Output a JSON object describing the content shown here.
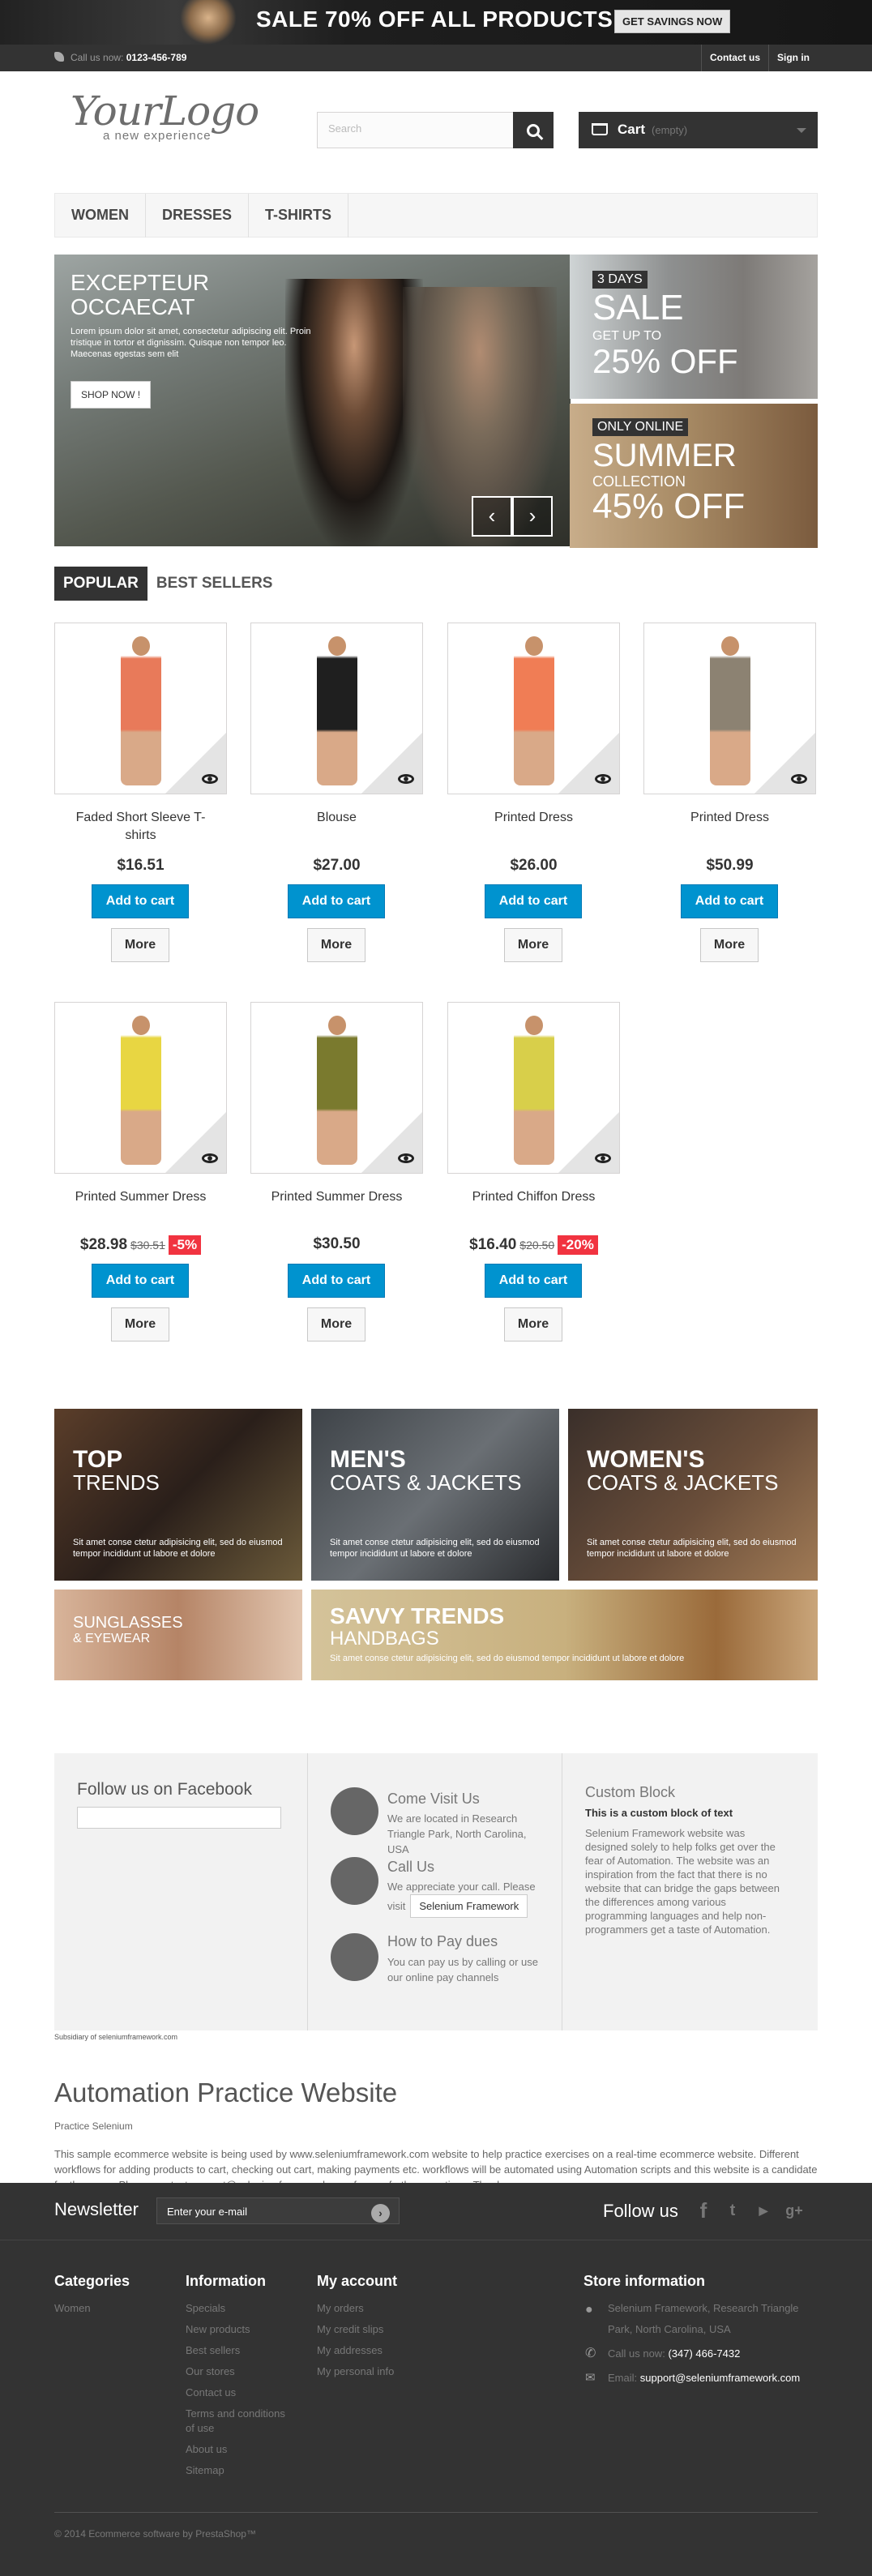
{
  "top_banner": {
    "text": "SALE 70% OFF ALL PRODUCTS",
    "button": "GET SAVINGS NOW"
  },
  "nav": {
    "call_label": "Call us now:",
    "phone": "0123-456-789",
    "links": [
      "Contact us",
      "Sign in"
    ]
  },
  "header": {
    "logo_main": "YourLogo",
    "logo_tagline": "a new experience",
    "search_placeholder": "Search",
    "cart_label": "Cart",
    "cart_status": "(empty)"
  },
  "menu": [
    "WOMEN",
    "DRESSES",
    "T-SHIRTS"
  ],
  "slider": {
    "title_line1": "EXCEPTEUR",
    "title_line2": "OCCAECAT",
    "text": "Lorem ipsum dolor sit amet, consectetur adipiscing elit. Proin tristique in tortor et dignissim. Quisque non tempor leo. Maecenas egestas sem elit",
    "button": "SHOP NOW !"
  },
  "promo1": {
    "tag": "3 DAYS",
    "line1": "SALE",
    "line2": "GET UP TO",
    "line3": "25% OFF"
  },
  "promo2": {
    "tag": "ONLY ONLINE",
    "line1": "SUMMER",
    "line2": "COLLECTION",
    "line3": "45% OFF"
  },
  "tabs": [
    "POPULAR",
    "BEST SELLERS"
  ],
  "products": [
    {
      "name": "Faded Short Sleeve T-shirts",
      "price": "$16.51",
      "old_price": "",
      "discount": "",
      "color": "#e87a5a"
    },
    {
      "name": "Blouse",
      "price": "$27.00",
      "old_price": "",
      "discount": "",
      "color": "#1f1f1f"
    },
    {
      "name": "Printed Dress",
      "price": "$26.00",
      "old_price": "",
      "discount": "",
      "color": "#f07d55"
    },
    {
      "name": "Printed Dress",
      "price": "$50.99",
      "old_price": "",
      "discount": "",
      "color": "#8c8272"
    },
    {
      "name": "Printed Summer Dress",
      "price": "$28.98",
      "old_price": "$30.51",
      "discount": "-5%",
      "color": "#e8d642"
    },
    {
      "name": "Printed Summer Dress",
      "price": "$30.50",
      "old_price": "",
      "discount": "",
      "color": "#7a7a2e"
    },
    {
      "name": "Printed Chiffon Dress",
      "price": "$16.40",
      "old_price": "$20.50",
      "discount": "-20%",
      "color": "#d8cf4a"
    }
  ],
  "add_to_cart": "Add to cart",
  "more": "More",
  "banners": [
    {
      "h1": "TOP",
      "h2": "TRENDS",
      "text": "Sit amet conse ctetur adipisicing elit, sed do eiusmod tempor incididunt ut labore et dolore"
    },
    {
      "h1": "MEN'S",
      "h2": "COATS & JACKETS",
      "text": "Sit amet conse ctetur adipisicing elit, sed do eiusmod tempor incididunt ut labore et dolore"
    },
    {
      "h1": "WOMEN'S",
      "h2": "COATS & JACKETS",
      "text": "Sit amet conse ctetur adipisicing elit, sed do eiusmod tempor incididunt ut labore et dolore"
    },
    {
      "h1": "SUNGLASSES",
      "h2": "& EYEWEAR",
      "text": ""
    },
    {
      "h1": "SAVVY TRENDS",
      "h2": "HANDBAGS",
      "text": "Sit amet conse ctetur adipisicing elit, sed do eiusmod tempor incididunt ut labore et dolore"
    }
  ],
  "facebook": {
    "title": "Follow us on Facebook"
  },
  "contact": {
    "visit_title": "Come Visit Us",
    "visit_text": "We are located in Research Triangle Park, North Carolina, USA",
    "call_title": "Call Us",
    "call_text": "We appreciate your call. Please visit",
    "call_button": "Selenium Framework",
    "pay_title": "How to Pay dues",
    "pay_text": "You can pay us by calling or use our online pay channels"
  },
  "custom_block": {
    "title": "Custom Block",
    "subtitle": "This is a custom block of text",
    "text": "Selenium Framework website was designed solely to help folks get over the fear of Automation. The website was an inspiration from the fact that there is no website that can bridge the gaps between the differences among various programming languages and help non-programmers get a taste of Automation."
  },
  "subsidiary": "Subsidiary of seleniumframework.com",
  "about": {
    "title": "Automation Practice Website",
    "subtitle": "Practice Selenium",
    "text": "This sample ecommerce website is being used by www.seleniumframework.com website to help practice exercises on a real-time ecommerce website. Different workflows for adding products to cart, checking out cart, making payments etc. workflows will be automated using Automation scripts and this website is a candidate for the same. Please contact support@seleniumframework.com for any further questions. Thanks."
  },
  "newsletter": {
    "title": "Newsletter",
    "placeholder": "Enter your e-mail",
    "follow": "Follow us"
  },
  "footer": {
    "categories_title": "Categories",
    "categories": [
      "Women"
    ],
    "information_title": "Information",
    "information": [
      "Specials",
      "New products",
      "Best sellers",
      "Our stores",
      "Contact us",
      "Terms and conditions of use",
      "About us",
      "Sitemap"
    ],
    "account_title": "My account",
    "account": [
      "My orders",
      "My credit slips",
      "My addresses",
      "My personal info"
    ],
    "store_title": "Store information",
    "store_address": "Selenium Framework, Research Triangle Park, North Carolina, USA",
    "store_call_label": "Call us now:",
    "store_phone": "(347) 466-7432",
    "store_email_label": "Email:",
    "store_email": "support@seleniumframework.com",
    "copyright": "© 2014 Ecommerce software by PrestaShop™"
  }
}
